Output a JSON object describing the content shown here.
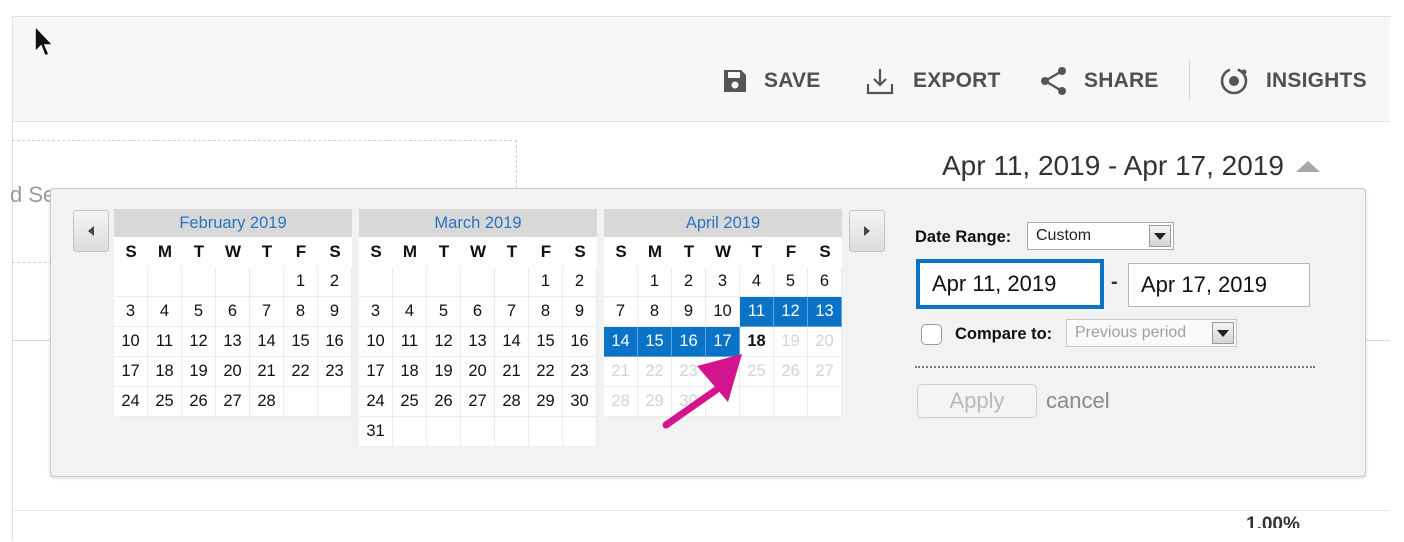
{
  "toolbar": {
    "save": "SAVE",
    "export": "EXPORT",
    "share": "SHARE",
    "insights": "INSIGHTS"
  },
  "background": {
    "partial_text": "d Se",
    "percent": "1.00%"
  },
  "date_display": "Apr 11, 2019 - Apr 17, 2019",
  "calendar": {
    "dow": [
      "S",
      "M",
      "T",
      "W",
      "T",
      "F",
      "S"
    ],
    "months": [
      {
        "title": "February 2019",
        "weeks": [
          [
            "",
            "",
            "",
            "",
            "",
            "1",
            "2"
          ],
          [
            "3",
            "4",
            "5",
            "6",
            "7",
            "8",
            "9"
          ],
          [
            "10",
            "11",
            "12",
            "13",
            "14",
            "15",
            "16"
          ],
          [
            "17",
            "18",
            "19",
            "20",
            "21",
            "22",
            "23"
          ],
          [
            "24",
            "25",
            "26",
            "27",
            "28",
            "",
            ""
          ]
        ]
      },
      {
        "title": "March 2019",
        "weeks": [
          [
            "",
            "",
            "",
            "",
            "",
            "1",
            "2"
          ],
          [
            "3",
            "4",
            "5",
            "6",
            "7",
            "8",
            "9"
          ],
          [
            "10",
            "11",
            "12",
            "13",
            "14",
            "15",
            "16"
          ],
          [
            "17",
            "18",
            "19",
            "20",
            "21",
            "22",
            "23"
          ],
          [
            "24",
            "25",
            "26",
            "27",
            "28",
            "29",
            "30"
          ],
          [
            "31",
            "",
            "",
            "",
            "",
            "",
            ""
          ]
        ]
      },
      {
        "title": "April 2019",
        "weeks": [
          [
            "",
            "1",
            "2",
            "3",
            "4",
            "5",
            "6"
          ],
          [
            "7",
            "8",
            "9",
            "10",
            "11",
            "12",
            "13"
          ],
          [
            "14",
            "15",
            "16",
            "17",
            "18",
            "19",
            "20"
          ],
          [
            "21",
            "22",
            "23",
            "24",
            "25",
            "26",
            "27"
          ],
          [
            "28",
            "29",
            "30",
            "",
            "",
            "",
            ""
          ]
        ],
        "selected": [
          "11",
          "12",
          "13",
          "14",
          "15",
          "16",
          "17"
        ],
        "today": "18",
        "disabled_from": 19
      }
    ]
  },
  "form": {
    "date_range_label": "Date Range:",
    "date_range_value": "Custom",
    "start_date": "Apr 11, 2019",
    "separator": "-",
    "end_date": "Apr 17, 2019",
    "compare_label": "Compare to:",
    "compare_value": "Previous period",
    "apply": "Apply",
    "cancel": "cancel"
  },
  "colors": {
    "selected": "#0a73c8",
    "month_title": "#2a73c4",
    "annotation_arrow": "#d4148f"
  }
}
